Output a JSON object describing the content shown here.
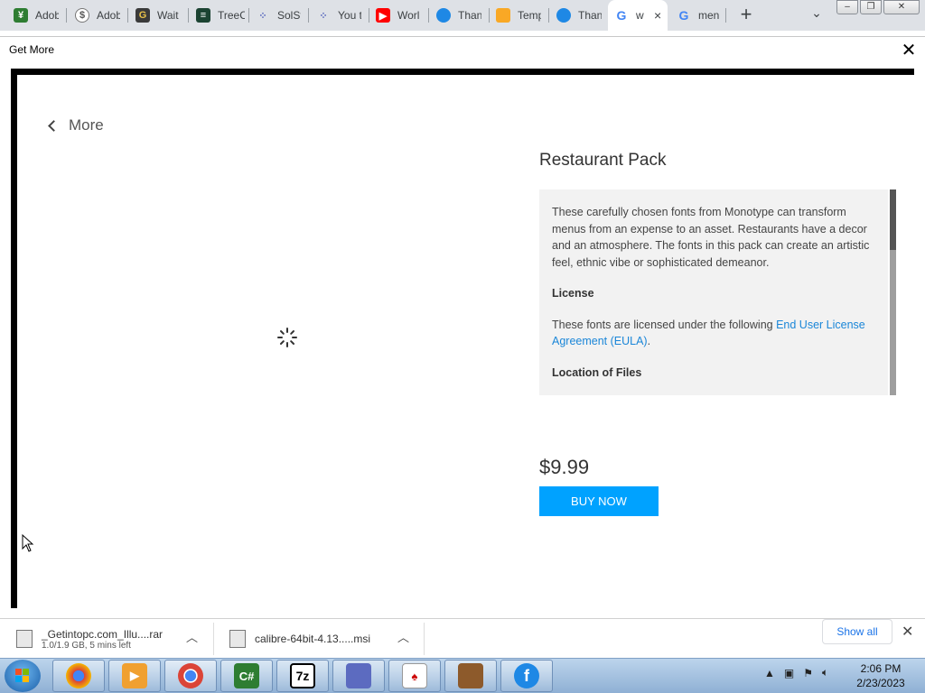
{
  "browser": {
    "tabs": [
      {
        "title": "Adob",
        "icon": "adobe-stock-icon",
        "color": "#2e7d32"
      },
      {
        "title": "Adob",
        "icon": "dollar-icon",
        "color": "#777777"
      },
      {
        "title": "Wait",
        "icon": "g-logo-icon",
        "color": "#3a3a3a"
      },
      {
        "title": "TreeC",
        "icon": "treecard-icon",
        "color": "#1b4332"
      },
      {
        "title": "SolSt",
        "icon": "dots-icon",
        "color": "#5c6bc0"
      },
      {
        "title": "You t",
        "icon": "dots-icon",
        "color": "#5c6bc0"
      },
      {
        "title": "Worl",
        "icon": "youtube-icon",
        "color": "#ff0000"
      },
      {
        "title": "Than",
        "icon": "balloon-icon",
        "color": "#1e88e5"
      },
      {
        "title": "Temp",
        "icon": "folder-icon",
        "color": "#f9a825"
      },
      {
        "title": "Than",
        "icon": "balloon-icon",
        "color": "#1e88e5"
      },
      {
        "title": "w",
        "icon": "google-icon",
        "color": "#4285f4",
        "active": true
      },
      {
        "title": "men",
        "icon": "google-icon",
        "color": "#4285f4"
      }
    ],
    "new_tab": "+",
    "tab_search": "⌄",
    "close_tab": "×"
  },
  "dialog": {
    "title": "Get More",
    "close": "✕",
    "back_label": "More",
    "pack": {
      "title": "Restaurant Pack",
      "description": "These carefully chosen fonts from Monotype can transform menus from an expense to an asset. Restaurants have a decor and an atmosphere. The fonts in this pack can create an artistic feel, ethnic vibe or sophisticated demeanor.",
      "license_heading": "License",
      "license_text": "These fonts are licensed under the following ",
      "license_link": "End User License Agreement (EULA)",
      "license_end": ".",
      "location_heading": "Location of Files",
      "price": "$9.99",
      "buy_label": "BUY NOW",
      "accent_color": "#00a2ff"
    }
  },
  "downloads": {
    "items": [
      {
        "name": "_Getintopc.com_Illu....rar",
        "status": "1.0/1.9 GB, 5 mins left"
      },
      {
        "name": "calibre-64bit-4.13.....msi",
        "status": ""
      }
    ],
    "show_all": "Show all",
    "close": "✕"
  },
  "taskbar": {
    "apps": [
      {
        "name": "chrome-old-icon",
        "label": ""
      },
      {
        "name": "media-player-icon",
        "label": ""
      },
      {
        "name": "chrome-icon",
        "label": ""
      },
      {
        "name": "csharp-icon",
        "label": "C#"
      },
      {
        "name": "7zip-icon",
        "label": "7z"
      },
      {
        "name": "setup-icon",
        "label": ""
      },
      {
        "name": "solitaire-icon",
        "label": ""
      },
      {
        "name": "books-icon",
        "label": ""
      },
      {
        "name": "font-icon",
        "label": "f"
      }
    ],
    "time": "2:06 PM",
    "date": "2/23/2023"
  }
}
